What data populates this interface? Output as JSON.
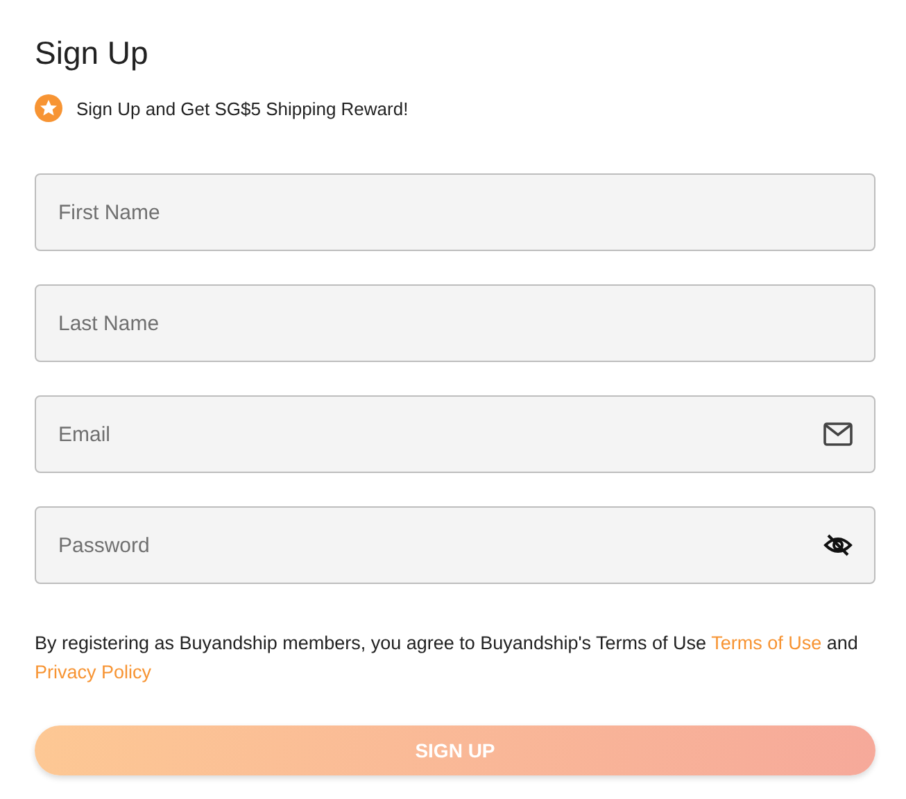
{
  "title": "Sign Up",
  "reward": {
    "text": "Sign Up and Get SG$5 Shipping Reward!"
  },
  "fields": [
    {
      "kind": "text",
      "placeholder": "First Name"
    },
    {
      "kind": "text",
      "placeholder": "Last Name"
    },
    {
      "kind": "email",
      "placeholder": "Email"
    },
    {
      "kind": "password",
      "placeholder": "Password"
    }
  ],
  "agreement": {
    "text": "By registering as Buyandship members, you agree to Buyandship's Terms of Use",
    "link_terms": "Terms of Use",
    "joiner": "and",
    "link_privacy": "Privacy Policy"
  },
  "submit": {
    "label": "SIGN UP"
  }
}
